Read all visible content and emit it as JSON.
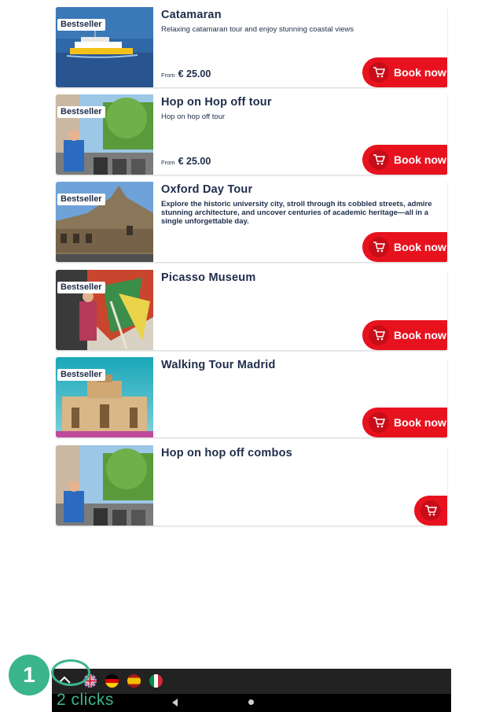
{
  "tours": [
    {
      "title": "Catamaran",
      "badge": "Bestseller",
      "description": "Relaxing catamaran tour and enjoy stunning coastal views",
      "price_prefix": "From",
      "price": "€ 25.00",
      "button_label": "Book now"
    },
    {
      "title": "Hop on Hop off tour",
      "badge": "Bestseller",
      "description": "Hop on hop off tour",
      "price_prefix": "From",
      "price": "€ 25.00",
      "button_label": "Book now"
    },
    {
      "title": "Oxford Day Tour",
      "badge": "Bestseller",
      "description": "Explore the historic university city, stroll through its cobbled streets, admire stunning architecture, and uncover centuries of academic heritage—all in a single unforgettable day.",
      "button_label": "Book now"
    },
    {
      "title": "Picasso Museum",
      "badge": "Bestseller",
      "button_label": "Book now"
    },
    {
      "title": "Walking Tour Madrid",
      "badge": "Bestseller",
      "button_label": "Book now"
    },
    {
      "title": "Hop on hop off combos"
    }
  ],
  "icons": {
    "cart": "shopping-cart-icon",
    "home": "home-icon",
    "back": "back-triangle-icon",
    "nav_home": "nav-home-dot-icon"
  },
  "languages": [
    "English",
    "German",
    "Spanish",
    "Italian"
  ],
  "annotation": {
    "step": "1",
    "clicks_label": "2 clicks"
  },
  "colors": {
    "brand_red": "#e8121f",
    "text_navy": "#1e2d4a",
    "annotation_green": "#3bb58b"
  }
}
